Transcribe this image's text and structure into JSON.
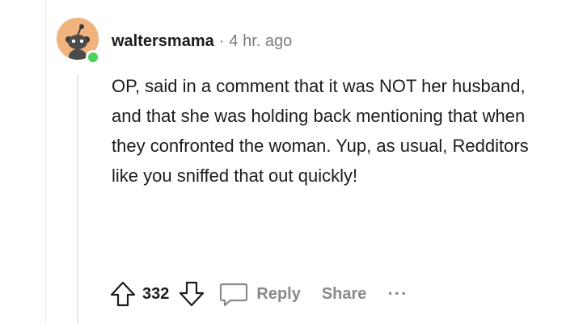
{
  "comment": {
    "username": "waltersmama",
    "separator": "·",
    "time": "4 hr. ago",
    "body": "OP, said in a comment that it was NOT her husband, and that she was holding back mentioning that when they confronted the woman. Yup, as usual, Redditors like you sniffed that out quickly!",
    "vote_count": "332",
    "reply_label": "Reply",
    "share_label": "Share",
    "more_label": "···"
  },
  "icons": {
    "avatar": "reddit-snoo-avatar",
    "online": "online-status-dot",
    "upvote": "upvote-arrow-icon",
    "downvote": "downvote-arrow-icon",
    "reply": "comment-bubble-icon",
    "more": "more-options-icon"
  },
  "colors": {
    "avatar_bg": "#f0b37e",
    "online": "#4bd35a",
    "muted": "#878a8c",
    "text": "#1c1c1c"
  }
}
